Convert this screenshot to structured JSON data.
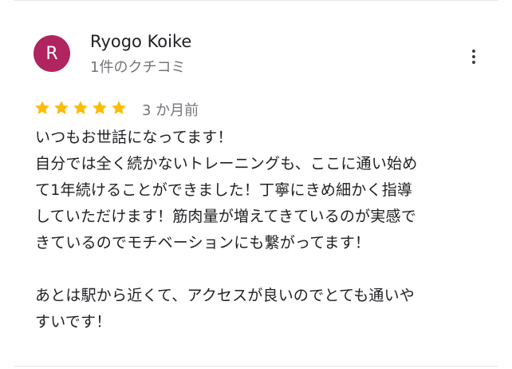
{
  "reviewer": {
    "avatar_initial": "R",
    "avatar_color": "#b0245f",
    "name": "Ryogo Koike",
    "review_count": "1件のクチコミ"
  },
  "menu": {
    "icon": "more-vert-icon"
  },
  "rating": {
    "stars": 5,
    "max_stars": 5,
    "star_color": "#fbbc04",
    "date": "3 か月前"
  },
  "review": {
    "lines": [
      "いつもお世話になってます！",
      "自分では全く続かないトレーニングも、ここに通い始め",
      "て1年続けることができました！丁寧にきめ細かく指導",
      "していただけます！筋肉量が増えてきているのが実感で",
      "きているのでモチベーションにも繋がってます！",
      "",
      "あとは駅から近くて、アクセスが良いのでとても通いや",
      "すいです！"
    ]
  }
}
